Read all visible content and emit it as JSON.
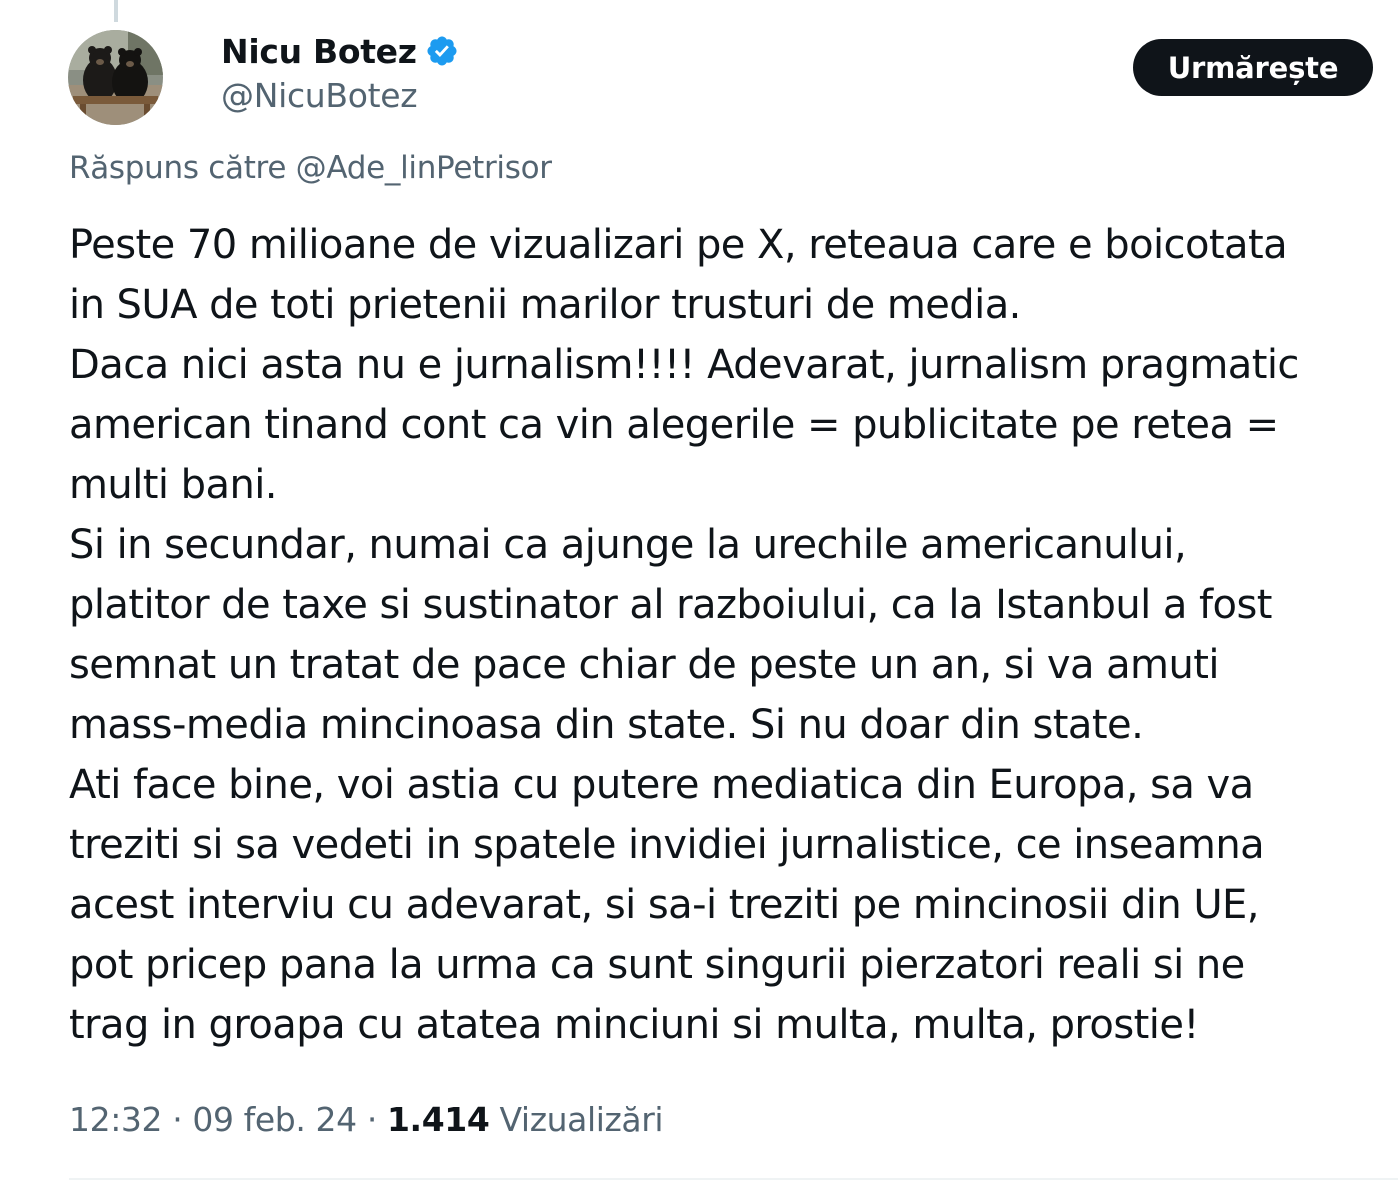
{
  "tweet": {
    "author": {
      "display_name": "Nicu Botez",
      "handle": "@NicuBotez",
      "verified_icon": "verified-badge-icon",
      "avatar": "avatar-two-bears"
    },
    "follow_label": "Urmărește",
    "reply_to": {
      "prefix": "Răspuns către",
      "mention": "@Ade_linPetrisor"
    },
    "text_lines": [
      "Peste 70 milioane de vizualizari pe X, reteaua care e boicotata",
      "in SUA de toti prietenii marilor trusturi de media.",
      "Daca nici asta nu e jurnalism!!!! Adevarat, jurnalism pragmatic",
      "american tinand cont ca vin alegerile = publicitate pe retea =",
      "multi bani.",
      "Si in secundar, numai ca ajunge la urechile americanului,",
      "platitor de taxe si sustinator al razboiului, ca la Istanbul a fost",
      "semnat un tratat de pace chiar de peste un an, si va amuti",
      "mass-media mincinoasa din state. Si nu doar din state.",
      "Ati face bine, voi astia cu putere mediatica din Europa, sa va",
      "treziti si sa vedeti in spatele invidiei jurnalistice, ce inseamna",
      "acest interviu cu adevarat, si sa-i treziti pe mincinosii din UE,",
      "pot pricep pana la urma ca sunt singurii pierzatori reali si ne",
      "trag in groapa cu atatea minciuni si multa, multa, prostie!"
    ],
    "time": "12:32",
    "separator": "·",
    "date": "09 feb. 24",
    "views_count": "1.414",
    "views_label": "Vizualizări"
  },
  "colors": {
    "text_primary": "#0f1419",
    "text_secondary": "#536471",
    "verified_blue": "#1d9bf0",
    "button_bg": "#0f1419",
    "button_text": "#ffffff",
    "divider": "#eff3f4"
  }
}
